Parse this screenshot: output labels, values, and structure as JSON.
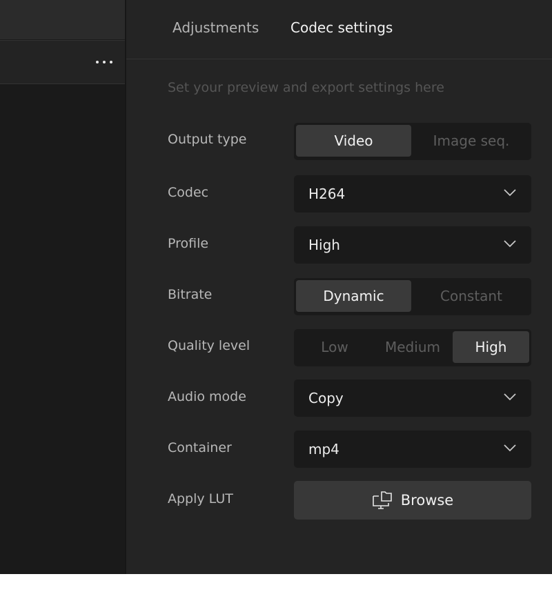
{
  "tabs": [
    {
      "label": "Adjustments",
      "active": false
    },
    {
      "label": "Codec settings",
      "active": true
    }
  ],
  "hint": "Set your preview and export settings here",
  "output_type": {
    "label": "Output type",
    "options": [
      "Video",
      "Image seq."
    ],
    "selected": "Video"
  },
  "codec": {
    "label": "Codec",
    "value": "H264"
  },
  "profile": {
    "label": "Profile",
    "value": "High"
  },
  "bitrate": {
    "label": "Bitrate",
    "options": [
      "Dynamic",
      "Constant"
    ],
    "selected": "Dynamic"
  },
  "quality": {
    "label": "Quality level",
    "options": [
      "Low",
      "Medium",
      "High"
    ],
    "selected": "High"
  },
  "audio_mode": {
    "label": "Audio mode",
    "value": "Copy"
  },
  "container": {
    "label": "Container",
    "value": "mp4"
  },
  "lut": {
    "label": "Apply LUT",
    "button_label": "Browse"
  },
  "icons": [
    "more-horizontal-icon",
    "chevron-down-icon",
    "browse-folder-monitor-icon"
  ]
}
